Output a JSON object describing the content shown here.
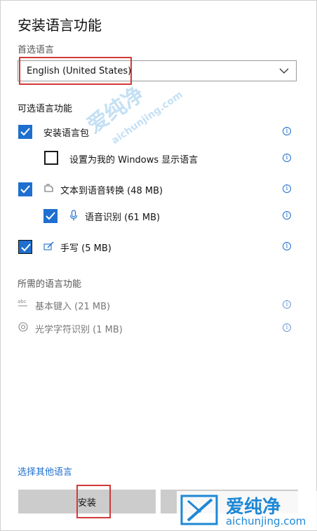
{
  "title": "安装语言功能",
  "preferred_language": {
    "label": "首选语言",
    "selected": "English (United States)"
  },
  "optional_features": {
    "heading": "可选语言功能",
    "items": [
      {
        "label": "安装语言包",
        "checked": true
      },
      {
        "label": "设置为我的 Windows 显示语言",
        "checked": false
      },
      {
        "label": "文本到语音转换 (48 MB)",
        "checked": true,
        "icon": "speech-icon"
      },
      {
        "label": "语音识别 (61 MB)",
        "checked": true,
        "icon": "microphone-icon"
      },
      {
        "label": "手写 (5 MB)",
        "checked": true,
        "icon": "pen-icon"
      }
    ]
  },
  "required_features": {
    "heading": "所需的语言功能",
    "items": [
      {
        "label": "基本键入 (21 MB)",
        "icon": "abc-icon"
      },
      {
        "label": "光学字符识别 (1 MB)",
        "icon": "ocr-camera-icon"
      }
    ]
  },
  "other_language_link": "选择其他语言",
  "buttons": {
    "install": "安装",
    "cancel": ""
  },
  "watermark": {
    "text": "爱纯净",
    "url": "aichunjing.com"
  },
  "colors": {
    "accent": "#1e6fcf",
    "highlight_box": "#d33a3a",
    "button_bg": "#cccccc"
  }
}
